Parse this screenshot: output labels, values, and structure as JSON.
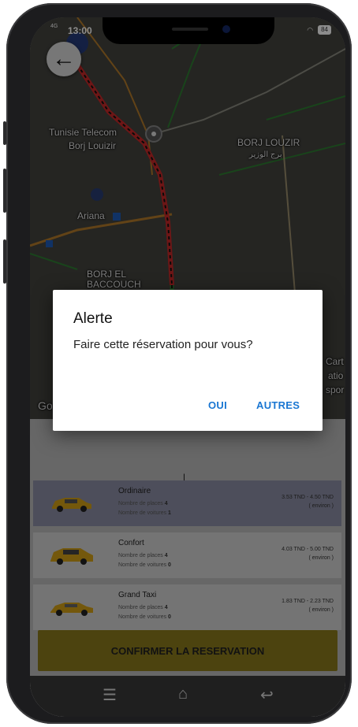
{
  "status_bar": {
    "network": "4G",
    "time": "13:00",
    "battery": "84"
  },
  "map": {
    "labels": {
      "tunisie_telecom": "Tunisie Telecom",
      "borj_louizir_1": "Borj Louizir",
      "borj_louzir": "BORJ LOUZIR",
      "borj_louzir_ar": "برج الوزير",
      "ariana": "Ariana",
      "borj_el_baccouch": "BORJ EL BACCOUCH",
      "google_fragment": "Go",
      "cart_fragment": "Cart",
      "atio_fragment": "atio",
      "spor_fragment": "spor"
    }
  },
  "dialog": {
    "title": "Alerte",
    "message": "Faire cette réservation pour vous?",
    "yes_label": "OUI",
    "others_label": "AUTRES"
  },
  "rides": [
    {
      "name": "Ordinaire",
      "places_label": "Nombre de places",
      "places": "4",
      "cars_label": "Nombre de voitures",
      "cars": "1",
      "price": "3.53 TND - 4.50 TND",
      "price_note": "( environ )"
    },
    {
      "name": "Confort",
      "places_label": "Nombre de places",
      "places": "4",
      "cars_label": "Nombre de voitures",
      "cars": "0",
      "price": "4.03 TND - 5.00 TND",
      "price_note": "( environ )"
    },
    {
      "name": "Grand Taxi",
      "places_label": "Nombre de places",
      "places": "4",
      "cars_label": "Nombre de voitures",
      "cars": "0",
      "price": "1.83 TND - 2.23 TND",
      "price_note": "( environ )"
    }
  ],
  "confirm_label": "CONFIRMER LA RESERVATION",
  "colors": {
    "accent_blue": "#1976d2",
    "confirm_yellow": "#f2d733",
    "route_red": "#c62828"
  }
}
